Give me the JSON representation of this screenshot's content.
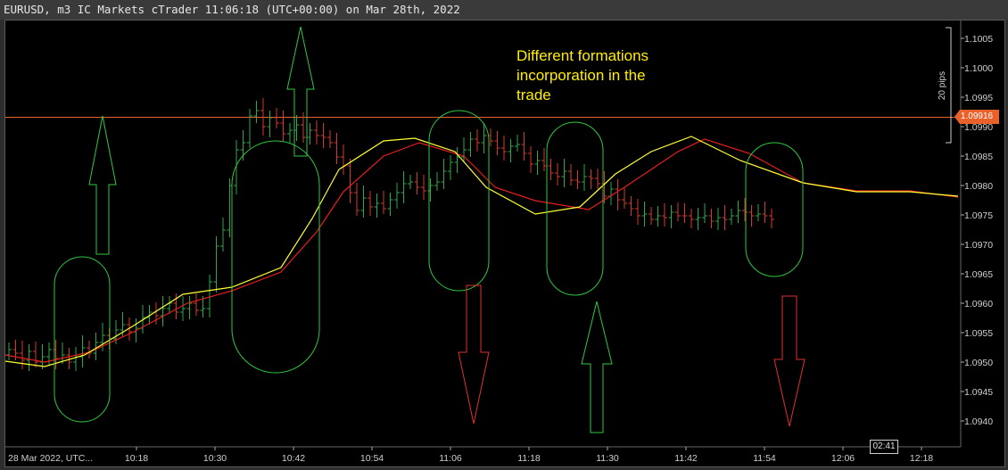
{
  "window": {
    "title": "EURUSD, m3 IC Markets cTrader 11:06:18 (UTC+00:00) on Mar 28th, 2022"
  },
  "annotation": {
    "text_lines": [
      "Different formations",
      "incorporation in the",
      "trade"
    ]
  },
  "price_axis": {
    "ticks": [
      "1.1005",
      "1.1000",
      "1.0995",
      "1.0990",
      "1.0985",
      "1.0980",
      "1.0975",
      "1.0970",
      "1.0965",
      "1.0960",
      "1.0955",
      "1.0950",
      "1.0945",
      "1.0940"
    ],
    "current_price": "1.09916",
    "range_label": "20 pips"
  },
  "time_axis": {
    "start_label": "28 Mar 2022, UTC...",
    "ticks": [
      "10:18",
      "10:30",
      "10:42",
      "10:54",
      "11:06",
      "11:18",
      "11:30",
      "11:42",
      "11:54",
      "12:06",
      "12:18"
    ],
    "cursor_label": "02:41"
  },
  "colors": {
    "bull": "#2ea84a",
    "bear": "#d23a2a",
    "ma_fast": "#ffff33",
    "ma_slow": "#e81e1e",
    "price_line": "#e8602a",
    "annotation": "#ffee00",
    "shape": "#2ec842",
    "arrow_down": "#e03030"
  },
  "chart_data": {
    "type": "candlestick",
    "symbol": "EURUSD",
    "timeframe": "m3",
    "ylim": [
      1.0937,
      1.1009
    ],
    "current_price": 1.09916
  }
}
